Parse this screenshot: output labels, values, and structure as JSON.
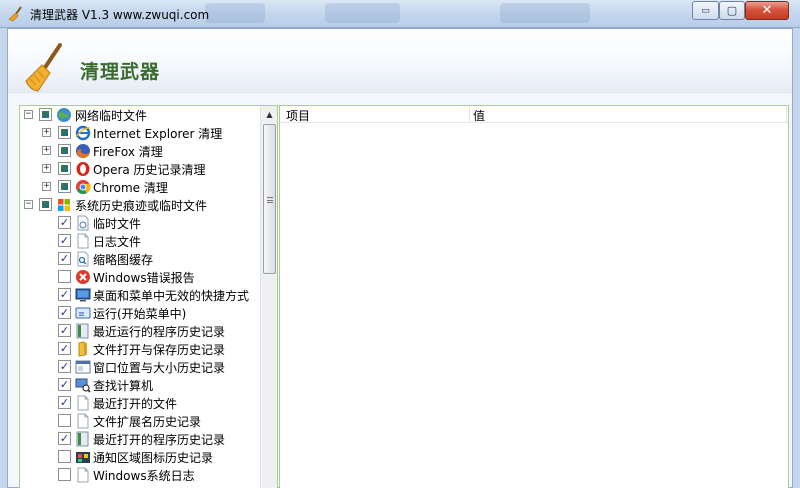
{
  "window": {
    "title": "清理武器 V1.3 www.zwuqi.com",
    "minimize_symbol": "▭",
    "maximize_symbol": "▢",
    "close_symbol": "✕"
  },
  "header": {
    "title": "清理武器"
  },
  "tree": {
    "items": [
      {
        "label": "网络临时文件",
        "level": 0,
        "expander": "−",
        "check": "partial",
        "icon": "globe-icon"
      },
      {
        "label": "Internet Explorer 清理",
        "level": 1,
        "expander": "+",
        "check": "partial",
        "icon": "internet-explorer-icon"
      },
      {
        "label": "FireFox 清理",
        "level": 1,
        "expander": "+",
        "check": "partial",
        "icon": "firefox-icon"
      },
      {
        "label": "Opera 历史记录清理",
        "level": 1,
        "expander": "+",
        "check": "partial",
        "icon": "opera-icon"
      },
      {
        "label": "Chrome 清理",
        "level": 1,
        "expander": "+",
        "check": "partial",
        "icon": "chrome-icon"
      },
      {
        "label": "系统历史痕迹或临时文件",
        "level": 0,
        "expander": "−",
        "check": "partial",
        "icon": "windows-icon"
      },
      {
        "label": "临时文件",
        "level": 2,
        "check": "checked",
        "icon": "temp-file-icon"
      },
      {
        "label": "日志文件",
        "level": 2,
        "check": "checked",
        "icon": "document-icon"
      },
      {
        "label": "缩略图缓存",
        "level": 2,
        "check": "checked",
        "icon": "thumbnail-cache-icon"
      },
      {
        "label": "Windows错误报告",
        "level": 2,
        "check": "unchecked",
        "icon": "error-icon"
      },
      {
        "label": "桌面和菜单中无效的快捷方式",
        "level": 2,
        "check": "checked",
        "icon": "desktop-icon"
      },
      {
        "label": "运行(开始菜单中)",
        "level": 2,
        "check": "checked",
        "icon": "run-icon"
      },
      {
        "label": "最近运行的程序历史记录",
        "level": 2,
        "check": "checked",
        "icon": "program-icon"
      },
      {
        "label": "文件打开与保存历史记录",
        "level": 2,
        "check": "checked",
        "icon": "folder-icon"
      },
      {
        "label": "窗口位置与大小历史记录",
        "level": 2,
        "check": "checked",
        "icon": "window-icon"
      },
      {
        "label": "查找计算机",
        "level": 2,
        "check": "checked",
        "icon": "search-computer-icon"
      },
      {
        "label": "最近打开的文件",
        "level": 2,
        "check": "checked",
        "icon": "document-icon"
      },
      {
        "label": "文件扩展名历史记录",
        "level": 2,
        "check": "unchecked",
        "icon": "document-icon"
      },
      {
        "label": "最近打开的程序历史记录",
        "level": 2,
        "check": "checked",
        "icon": "program-icon"
      },
      {
        "label": "通知区域图标历史记录",
        "level": 2,
        "check": "unchecked",
        "icon": "tray-icon"
      },
      {
        "label": "Windows系统日志",
        "level": 2,
        "check": "unchecked",
        "icon": "document-icon"
      }
    ]
  },
  "scrollbar": {
    "up_arrow": "▲"
  },
  "list": {
    "columns": [
      "项目",
      "值"
    ]
  }
}
